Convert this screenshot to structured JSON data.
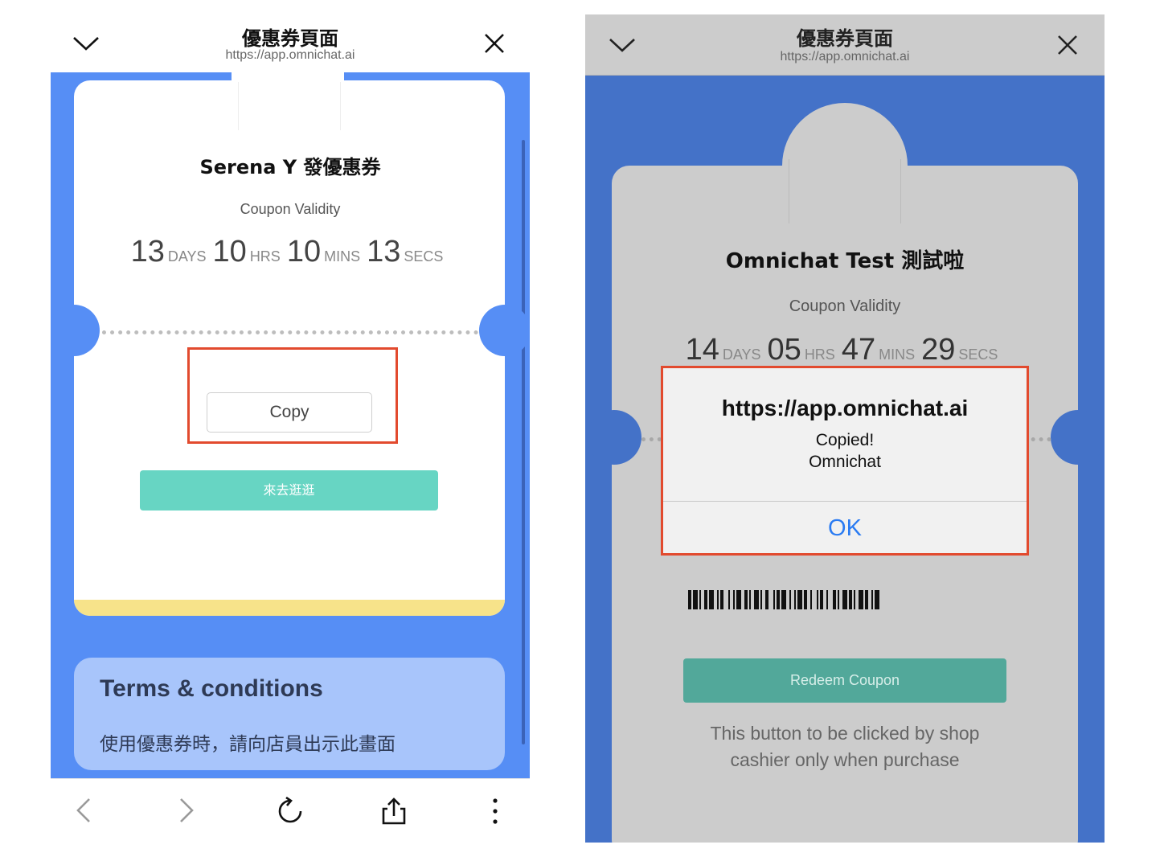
{
  "left_screen": {
    "header": {
      "title": "優惠券頁面",
      "url": "https://app.omnichat.ai",
      "collapse_icon": "chevron-down-icon",
      "close_icon": "close-icon"
    },
    "coupon": {
      "title": "Serena Y 發優惠券",
      "validity_label": "Coupon Validity",
      "countdown": {
        "days": "13",
        "days_unit": "DAYS",
        "hrs": "10",
        "hrs_unit": "HRS",
        "mins": "10",
        "mins_unit": "MINS",
        "secs": "13",
        "secs_unit": "SECS"
      },
      "copy_button": "Copy",
      "shop_button": "來去逛逛"
    },
    "terms": {
      "title": "Terms & conditions",
      "body": "使用優惠券時，請向店員出示此畫面"
    },
    "toolbar": [
      "back-icon",
      "forward-icon",
      "reload-icon",
      "share-icon",
      "more-icon"
    ]
  },
  "right_screen": {
    "header": {
      "title": "優惠券頁面",
      "url": "https://app.omnichat.ai"
    },
    "coupon": {
      "title": "Omnichat Test 測試啦",
      "validity_label": "Coupon Validity",
      "countdown": {
        "days": "14",
        "days_unit": "DAYS",
        "hrs": "05",
        "hrs_unit": "HRS",
        "mins": "47",
        "mins_unit": "MINS",
        "secs": "29",
        "secs_unit": "SECS"
      },
      "redeem_button": "Redeem Coupon",
      "cashier_note_line1": "This button to be clicked by shop",
      "cashier_note_line2": "cashier only when purchase"
    },
    "alert": {
      "title": "https://app.omnichat.ai",
      "message_line1": "Copied!",
      "message_line2": "Omnichat",
      "ok_button": "OK"
    }
  },
  "colors": {
    "left_background": "#568ef5",
    "right_background": "#4472c8",
    "highlight_box": "#e24a2e",
    "shop_button": "#67d5c3",
    "redeem_button": "#52a89a",
    "ok_text": "#2a7bf2"
  }
}
